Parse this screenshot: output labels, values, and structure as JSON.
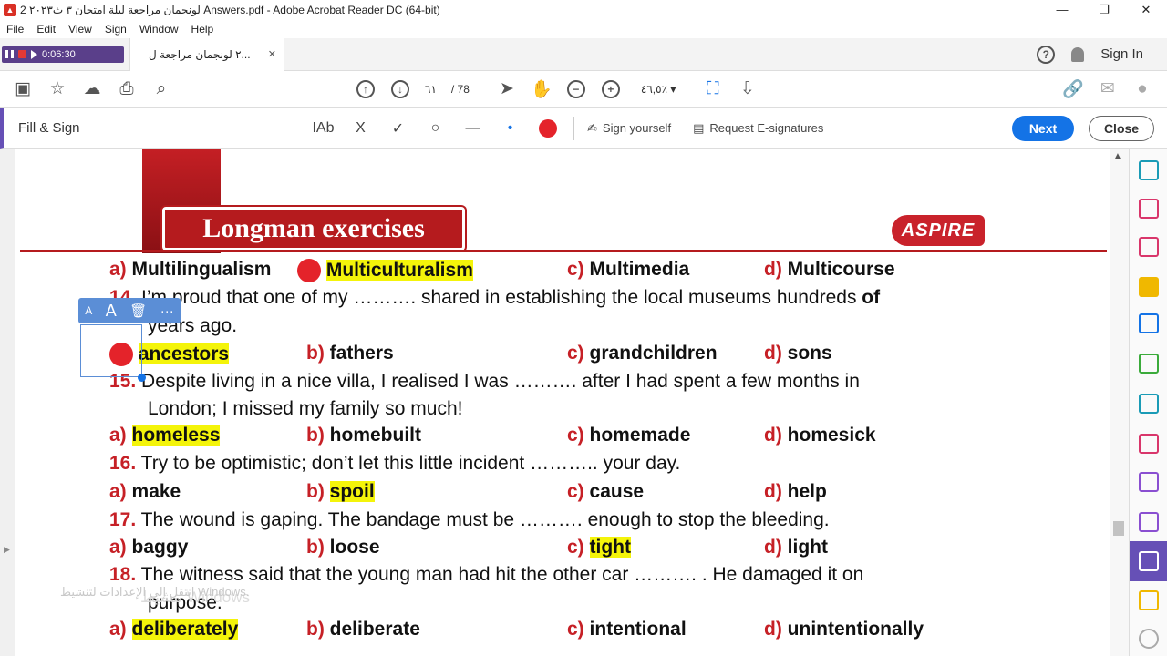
{
  "window": {
    "title": "لونجمان مراجعة ليلة امتحان ٣ ث٢٠٢٣ 2 Answers.pdf - Adobe Acrobat Reader DC (64-bit)",
    "minimize": "—",
    "maximize": "❐",
    "close": "✕"
  },
  "menu": [
    "File",
    "Edit",
    "View",
    "Sign",
    "Window",
    "Help"
  ],
  "recorder": {
    "time": "0:06:30"
  },
  "tab": {
    "label": "٢ لونجمان مراجعة ل...",
    "close": "✕"
  },
  "header": {
    "signin": "Sign In"
  },
  "toolbar": {
    "page_current": "٦١",
    "page_total": "/ 78",
    "zoom": "٤٦,٥٪"
  },
  "fillsign": {
    "title": "Fill & Sign",
    "tools": [
      "IAb",
      "X",
      "✓",
      "○",
      "—",
      "•"
    ],
    "sign_yourself": "Sign yourself",
    "request": "Request E-signatures",
    "next": "Next",
    "close": "Close"
  },
  "banner": {
    "title": "Longman exercises",
    "logo": "ASPIRE"
  },
  "questions": {
    "q13_opts": [
      "a)",
      "Multilingualism",
      "Multiculturalism",
      "c)",
      "Multimedia",
      "d)",
      "Multicourse"
    ],
    "q14_num": "14.",
    "q14_text": "I’m proud that one of my ………. shared in establishing the local museums hundreds",
    "q14_of": "of",
    "q14_text2": "years ago.",
    "q14_opts": [
      "ancestors",
      "b)",
      "fathers",
      "c)",
      "grandchildren",
      "d)",
      "sons"
    ],
    "q15_num": "15.",
    "q15_text": "Despite living in a nice villa, I realised I was ………. after I had spent a few months in",
    "q15_text2": "London; I missed my family so much!",
    "q15_opts": [
      "a)",
      "homeless",
      "b)",
      "homebuilt",
      "c)",
      "homemade",
      "d)",
      "homesick"
    ],
    "q16_num": "16.",
    "q16_text": "Try to be optimistic; don’t let this little incident ……….. your day.",
    "q16_opts": [
      "a)",
      "make",
      "b)",
      "spoil",
      "c)",
      "cause",
      "d)",
      "help"
    ],
    "q17_num": "17.",
    "q17_text": "The wound is gaping. The bandage must be ………. enough to stop the bleeding.",
    "q17_opts": [
      "a)",
      "baggy",
      "b)",
      "loose",
      "c)",
      "tight",
      "d)",
      "light"
    ],
    "q18_num": "18.",
    "q18_text": "The witness said that the young man had hit the other car ………. . He damaged it on",
    "q18_text2": "purpose.",
    "q18_opts": [
      "a)",
      "deliberately",
      "b)",
      "deliberate",
      "c)",
      "intentional",
      "d)",
      "unintentionally"
    ]
  },
  "float_toolbar": {
    "small_a": "A",
    "big_a": "A",
    "more": "···"
  },
  "watermark": {
    "line1": "تنشيط Windows",
    "line2": "انتقل إلى الإعدادات لتنشيط Windows."
  }
}
